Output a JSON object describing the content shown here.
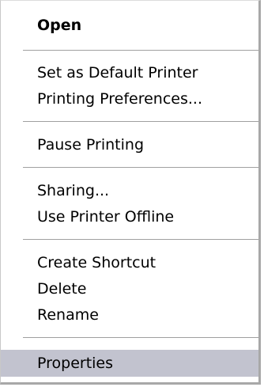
{
  "menu": {
    "open": "Open",
    "set_default_printer": "Set as Default Printer",
    "printing_preferences": "Printing Preferences...",
    "pause_printing": "Pause Printing",
    "sharing": "Sharing...",
    "use_printer_offline": "Use Printer Offline",
    "create_shortcut": "Create Shortcut",
    "delete": "Delete",
    "rename": "Rename",
    "properties": "Properties"
  },
  "highlighted_item": "properties",
  "colors": {
    "highlight": "#c2c3cf",
    "separator": "#a0a0a0",
    "background": "#ffffff"
  }
}
